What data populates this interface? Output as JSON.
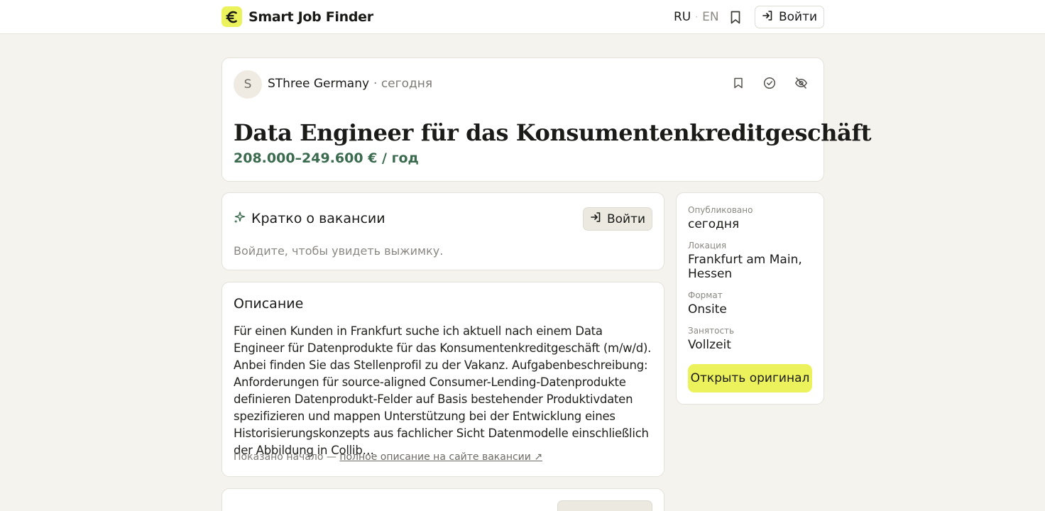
{
  "header": {
    "brand_name": "Smart Job Finder",
    "brand_icon": "euro-icon",
    "lang_active": "RU",
    "lang_separator": "·",
    "lang_inactive": "EN",
    "login_label": "Войти",
    "accent_color": "#ecf25b"
  },
  "job": {
    "avatar_letter": "S",
    "company": "SThree Germany",
    "posted": "· сегодня",
    "title": "Data Engineer für das Konsumentenkreditgeschäft",
    "salary": "208.000–249.600 € / год",
    "actions": [
      "bookmark-icon",
      "check-circle-icon",
      "eye-off-icon"
    ]
  },
  "summary": {
    "title": "Кратко о вакансии",
    "login_label": "Войти",
    "text": "Войдите, чтобы увидеть выжимку."
  },
  "description": {
    "title": "Описание",
    "body": "Für einen Kunden in Frankfurt suche ich aktuell nach einem Data Engineer für Datenprodukte für das Konsumentenkreditgeschäft (m/w/d). Anbei finden Sie das Stellenprofil zu der Vakanz. Aufgabenbeschreibung: Anforderungen für source-aligned Consumer-Lending-Datenprodukte definieren Datenprodukt-Felder auf Basis bestehender Produktivdaten spezifizieren und mappen Unterstützung bei der Entwicklung eines Historisierungskonzepts aus fachlicher Sicht Datenmodelle einschließlich der Abbildung in Collib…",
    "more_prefix": "Показано начало — ",
    "more_link": "полное описание на сайте вакансии ↗"
  },
  "sidebar": {
    "published_label": "Опубликовано",
    "published_value": "сегодня",
    "location_label": "Локация",
    "location_value": "Frankfurt am Main, Hessen",
    "format_label": "Формат",
    "format_value": "Onsite",
    "employment_label": "Занятость",
    "employment_value": "Vollzeit",
    "open_button": "Открыть оригинал"
  }
}
